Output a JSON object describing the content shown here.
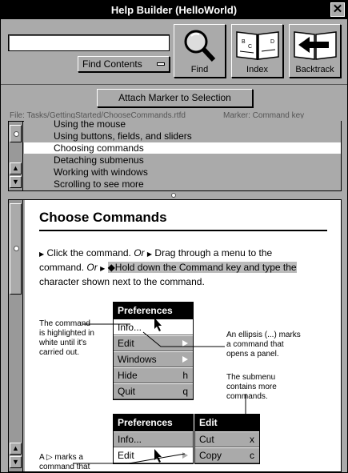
{
  "window": {
    "title": "Help Builder (HelloWorld)",
    "close_glyph": "✕"
  },
  "toolbar": {
    "search_value": "",
    "popup_label": "Find Contents",
    "find_label": "Find",
    "index_label": "Index",
    "backtrack_label": "Backtrack"
  },
  "attach_label": "Attach Marker to Selection",
  "file_line": "File: Tasks/GettingStarted/ChooseCommands.rtfd",
  "marker_line": "Marker: Command key",
  "list": {
    "items": [
      "Using the mouse",
      "Using buttons, fields, and sliders",
      "Choosing commands",
      "Detaching submenus",
      "Working with windows",
      "Scrolling to see more"
    ],
    "selected_index": 2
  },
  "doc": {
    "title": "Choose Commands",
    "p_click": "Click the command.",
    "p_or1": "Or",
    "p_drag": "Drag through a menu to the command.",
    "p_or2": "Or",
    "p_hold": "Hold down the Command key and type the",
    "p_tail": "character shown next to the command.",
    "note_highlight": "The command is highlighted in white until it's carried out.",
    "note_ellipsis": "An ellipsis (...) marks a command that opens a panel.",
    "note_submenu": "The submenu contains more commands.",
    "note_arrow": "A ▷ marks a command that",
    "menu1": {
      "header": "Preferences",
      "items": [
        {
          "label": "Info...",
          "key": ""
        },
        {
          "label": "Edit",
          "key": ""
        },
        {
          "label": "Windows",
          "key": ""
        },
        {
          "label": "Hide",
          "key": "h"
        },
        {
          "label": "Quit",
          "key": "q"
        }
      ]
    },
    "menu2": {
      "header": "Preferences",
      "items": [
        {
          "label": "Info...",
          "key": ""
        },
        {
          "label": "Edit",
          "key": ""
        }
      ]
    },
    "menu3": {
      "header": "Edit",
      "items": [
        {
          "label": "Cut",
          "key": "x"
        },
        {
          "label": "Copy",
          "key": "c"
        }
      ]
    }
  }
}
